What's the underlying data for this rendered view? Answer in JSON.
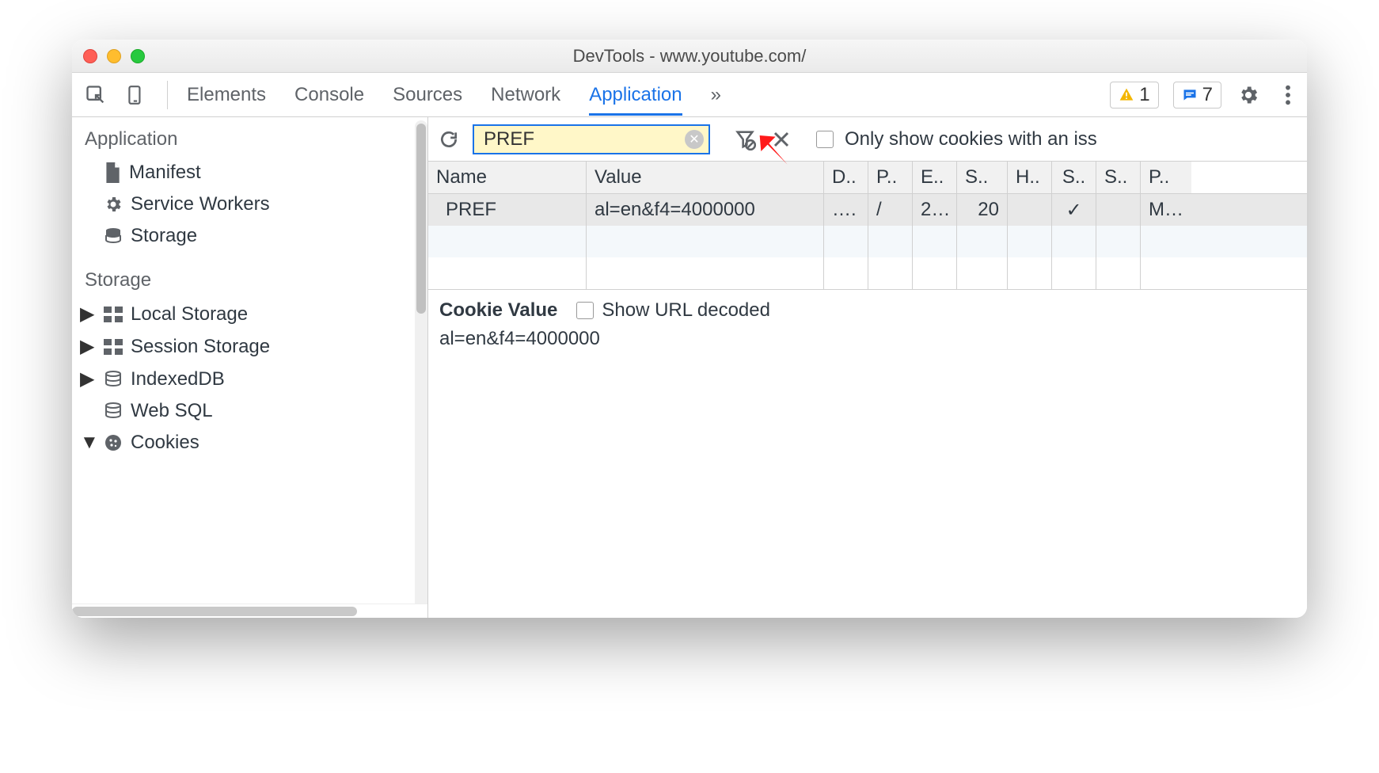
{
  "window": {
    "title": "DevTools - www.youtube.com/"
  },
  "toolbar": {
    "tabs": [
      "Elements",
      "Console",
      "Sources",
      "Network",
      "Application"
    ],
    "active_tab": "Application",
    "overflow": "»",
    "warning_count": "1",
    "message_count": "7"
  },
  "sidebar": {
    "sections": [
      {
        "title": "Application",
        "items": [
          {
            "label": "Manifest",
            "icon": "file",
            "caret": ""
          },
          {
            "label": "Service Workers",
            "icon": "gear",
            "caret": ""
          },
          {
            "label": "Storage",
            "icon": "db",
            "caret": ""
          }
        ]
      },
      {
        "title": "Storage",
        "items": [
          {
            "label": "Local Storage",
            "icon": "grid",
            "caret": "▶"
          },
          {
            "label": "Session Storage",
            "icon": "grid",
            "caret": "▶"
          },
          {
            "label": "IndexedDB",
            "icon": "db",
            "caret": "▶"
          },
          {
            "label": "Web SQL",
            "icon": "db",
            "caret": ""
          },
          {
            "label": "Cookies",
            "icon": "cookie",
            "caret": "▼"
          }
        ]
      }
    ]
  },
  "filter": {
    "value": "PREF",
    "only_issue_label": "Only show cookies with an iss"
  },
  "cookies": {
    "columns": [
      "Name",
      "Value",
      "D..",
      "P..",
      "E..",
      "S..",
      "H..",
      "S..",
      "S..",
      "P.."
    ],
    "rows": [
      {
        "name": "PREF",
        "value": "al=en&f4=4000000",
        "d": "….",
        "p": "/",
        "e": "2…",
        "s": "20",
        "h": "",
        "sec": "✓",
        "s2": "",
        "pr": "M…"
      }
    ]
  },
  "detail": {
    "header": "Cookie Value",
    "show_url_decoded_label": "Show URL decoded",
    "value": "al=en&f4=4000000"
  }
}
